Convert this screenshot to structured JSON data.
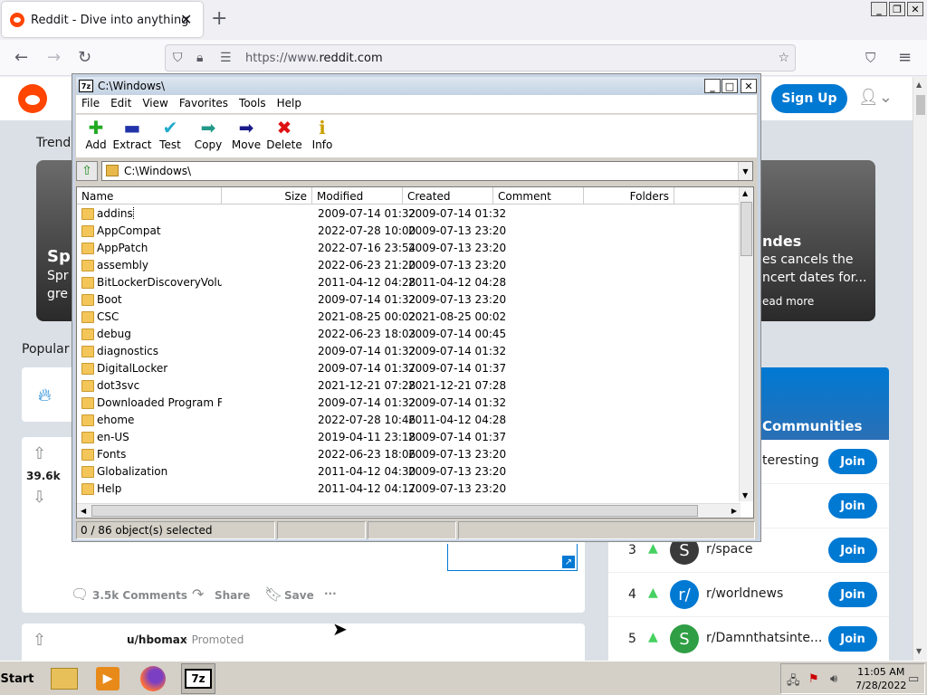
{
  "browser": {
    "tab_title": "Reddit - Dive into anything",
    "tab_close": "✕",
    "new_tab": "+",
    "url_prefix": "https://www.",
    "url_domain": "reddit.com",
    "window_controls": [
      "_",
      "❐",
      "✕"
    ]
  },
  "reddit": {
    "signup_label": "Sign Up",
    "trending_label": "Trend",
    "popular_label": "Popular",
    "trend_left_title": "Sp",
    "trend_left_sub1": "Spr",
    "trend_left_sub2": "gre",
    "trend_right_title": "ndes",
    "trend_right_sub1": "es cancels the",
    "trend_right_sub2": "ncert dates for...",
    "trend_right_more": "ead more",
    "votes": "39.6k",
    "comments": "3.5k Comments",
    "share": "Share",
    "save": "Save",
    "more": "···",
    "promoted_user": "u/hbomax",
    "promoted_label": "· Promoted",
    "communities_title": "Communities",
    "communities": [
      {
        "rank": "",
        "name": "teresting",
        "join": "Join",
        "avatar": "",
        "color": "#ffffff"
      },
      {
        "rank": "",
        "name": "",
        "join": "Join",
        "avatar": "",
        "color": "#ffffff"
      },
      {
        "rank": "3",
        "name": "r/space",
        "join": "Join",
        "avatar": "S",
        "color": "#3a3a3a"
      },
      {
        "rank": "4",
        "name": "r/worldnews",
        "join": "Join",
        "avatar": "r/",
        "color": "#0079d3"
      },
      {
        "rank": "5",
        "name": "r/Damnthatsinte...",
        "join": "Join",
        "avatar": "S",
        "color": "#2f9e44"
      }
    ]
  },
  "sevenzip": {
    "title": "C:\\Windows\\",
    "app_icon": "7z",
    "menu": [
      "File",
      "Edit",
      "View",
      "Favorites",
      "Tools",
      "Help"
    ],
    "toolbar": [
      {
        "label": "Add",
        "icon": "add-icon",
        "glyph": "✚",
        "color": "#22aa22"
      },
      {
        "label": "Extract",
        "icon": "extract-icon",
        "glyph": "▬",
        "color": "#2233aa"
      },
      {
        "label": "Test",
        "icon": "test-icon",
        "glyph": "✔",
        "color": "#22aacc"
      },
      {
        "label": "Copy",
        "icon": "copy-icon",
        "glyph": "➡",
        "color": "#229988"
      },
      {
        "label": "Move",
        "icon": "move-icon",
        "glyph": "➡",
        "color": "#1a1a8a"
      },
      {
        "label": "Delete",
        "icon": "delete-icon",
        "glyph": "✖",
        "color": "#dd1111"
      },
      {
        "label": "Info",
        "icon": "info-icon",
        "glyph": "ℹ",
        "color": "#c8a000"
      }
    ],
    "address": "C:\\Windows\\",
    "columns": [
      "Name",
      "Size",
      "Modified",
      "Created",
      "Comment",
      "Folders"
    ],
    "rows": [
      {
        "name": "addins",
        "modified": "2009-07-14 01:32",
        "created": "2009-07-14 01:32"
      },
      {
        "name": "AppCompat",
        "modified": "2022-07-28 10:00",
        "created": "2009-07-13 23:20"
      },
      {
        "name": "AppPatch",
        "modified": "2022-07-16 23:54",
        "created": "2009-07-13 23:20"
      },
      {
        "name": "assembly",
        "modified": "2022-06-23 21:20",
        "created": "2009-07-13 23:20"
      },
      {
        "name": "BitLockerDiscoveryVolu...",
        "modified": "2011-04-12 04:28",
        "created": "2011-04-12 04:28"
      },
      {
        "name": "Boot",
        "modified": "2009-07-14 01:32",
        "created": "2009-07-13 23:20"
      },
      {
        "name": "CSC",
        "modified": "2021-08-25 00:02",
        "created": "2021-08-25 00:02"
      },
      {
        "name": "debug",
        "modified": "2022-06-23 18:03",
        "created": "2009-07-14 00:45"
      },
      {
        "name": "diagnostics",
        "modified": "2009-07-14 01:32",
        "created": "2009-07-14 01:32"
      },
      {
        "name": "DigitalLocker",
        "modified": "2009-07-14 01:37",
        "created": "2009-07-14 01:37"
      },
      {
        "name": "dot3svc",
        "modified": "2021-12-21 07:28",
        "created": "2021-12-21 07:28"
      },
      {
        "name": "Downloaded Program F...",
        "modified": "2009-07-14 01:32",
        "created": "2009-07-14 01:32"
      },
      {
        "name": "ehome",
        "modified": "2022-07-28 10:46",
        "created": "2011-04-12 04:28"
      },
      {
        "name": "en-US",
        "modified": "2019-04-11 23:18",
        "created": "2009-07-14 01:37"
      },
      {
        "name": "Fonts",
        "modified": "2022-06-23 18:06",
        "created": "2009-07-13 23:20"
      },
      {
        "name": "Globalization",
        "modified": "2011-04-12 04:30",
        "created": "2009-07-13 23:20"
      },
      {
        "name": "Help",
        "modified": "2011-04-12 04:17",
        "created": "2009-07-13 23:20"
      }
    ],
    "status": "0 / 86 object(s) selected"
  },
  "taskbar": {
    "start": "Start",
    "time": "11:05 AM",
    "date": "7/28/2022"
  }
}
